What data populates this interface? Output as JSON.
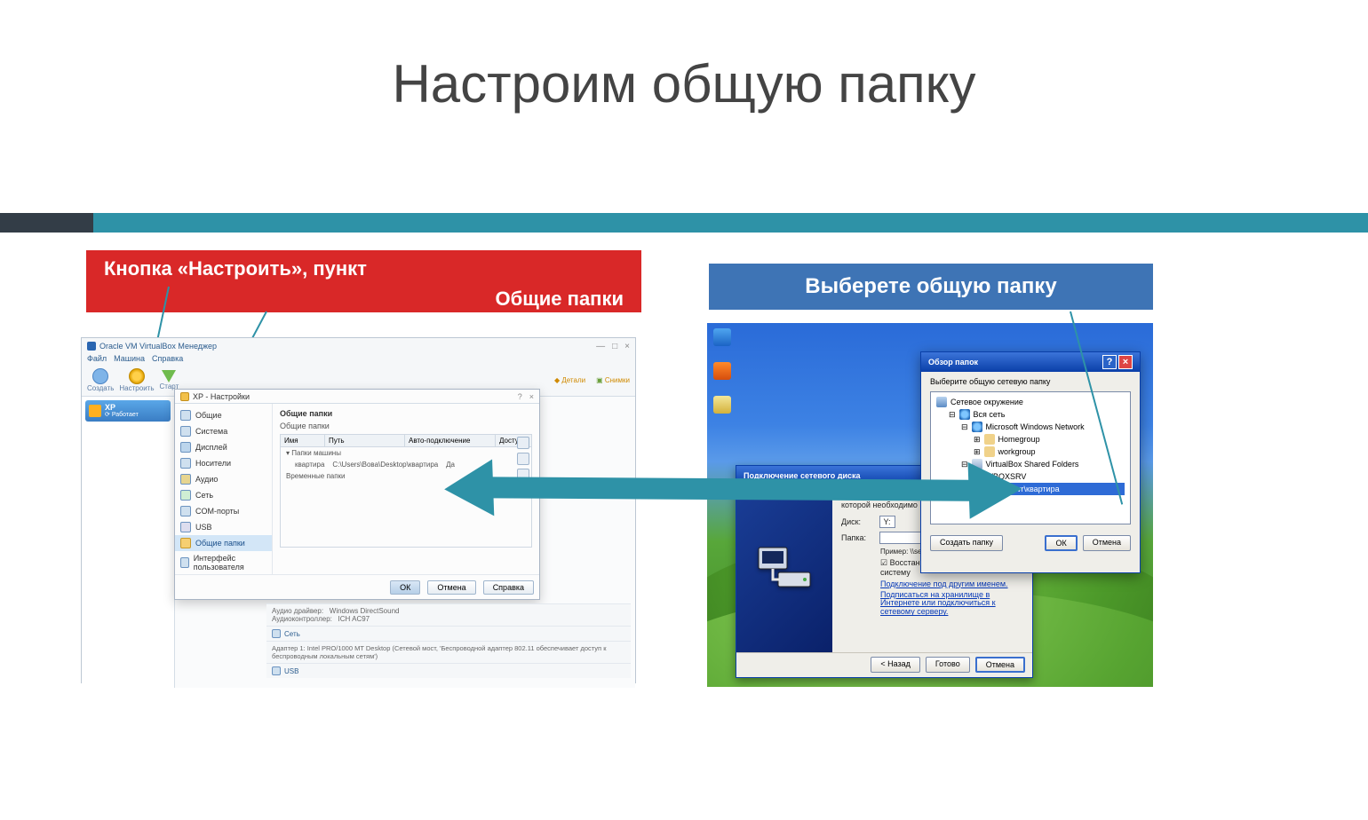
{
  "slide": {
    "title": "Настроим общую папку"
  },
  "callouts": {
    "left_line1": "Кнопка «Настроить», пункт",
    "left_line2": "Общие папки",
    "right": "Выберете общую папку"
  },
  "vb": {
    "app_title": "Oracle VM VirtualBox Менеджер",
    "menu": [
      "Файл",
      "Машина",
      "Справка"
    ],
    "toolbar": {
      "create": "Создать",
      "settings": "Настроить",
      "start": "Старт"
    },
    "toolbar_right": {
      "details": "Детали",
      "snapshots": "Снимки"
    },
    "win_controls": {
      "min": "—",
      "max": "□",
      "close": "×"
    },
    "machine": "Работает"
  },
  "vbs": {
    "title": "XP - Настройки",
    "side": [
      "Общие",
      "Система",
      "Дисплей",
      "Носители",
      "Аудио",
      "Сеть",
      "COM-порты",
      "USB",
      "Общие папки",
      "Интерфейс пользователя"
    ],
    "heading": "Общие папки",
    "sub": "Общие папки",
    "cols": {
      "name": "Имя",
      "path": "Путь",
      "auto": "Авто-подключение",
      "access": "Доступ"
    },
    "group": "Папки машины",
    "row": {
      "name": "квартира",
      "path": "C:\\Users\\Вова\\Desktop\\квартира",
      "auto": "Да"
    },
    "temp": "Временные папки",
    "buttons": {
      "ok": "ОК",
      "cancel": "Отмена",
      "help": "Справка"
    },
    "detail": {
      "audio_label": "Аудио драйвер:",
      "audio_val": "Windows DirectSound",
      "audio_ctl_label": "Аудиоконтроллер:",
      "audio_ctl_val": "ICH AC97",
      "net": "Сеть",
      "net_text": "Адаптер 1:   Intel PRO/1000 MT Desktop (Сетевой мост, 'Беспроводной адаптер 802.11 обеспечивает доступ к беспроводным локальным сетям')",
      "usb": "USB"
    }
  },
  "xp_wizard": {
    "title": "Подключение сетевого диска",
    "intro": "Укажите букву диска для подключения и папку, к которой необходимо подключиться:",
    "drive_label": "Диск:",
    "drive_value": "Y:",
    "folder_label": "Папка:",
    "example": "Пример: \\\\server\\share",
    "reconnect": "Восстанавливать при входе в систему",
    "other_user": "Подключение под другим именем.",
    "signup": "Подписаться на хранилище в Интернете или подключиться к сетевому серверу.",
    "buttons": {
      "back": "< Назад",
      "finish": "Готово",
      "cancel": "Отмена"
    }
  },
  "xp_browse": {
    "title": "Обзор папок",
    "prompt": "Выберите общую сетевую папку",
    "tree": {
      "root": "Сетевое окружение",
      "net": "Вся сеть",
      "msnet": "Microsoft Windows Network",
      "grp1": "Homegroup",
      "grp2": "workgroup",
      "vbshare": "VirtualBox Shared Folders",
      "vbhost": "VBOXSRV",
      "selected": "\\\\Vboxsvr\\квартира"
    },
    "buttons": {
      "new": "Создать папку",
      "ok": "ОК",
      "cancel": "Отмена"
    }
  }
}
